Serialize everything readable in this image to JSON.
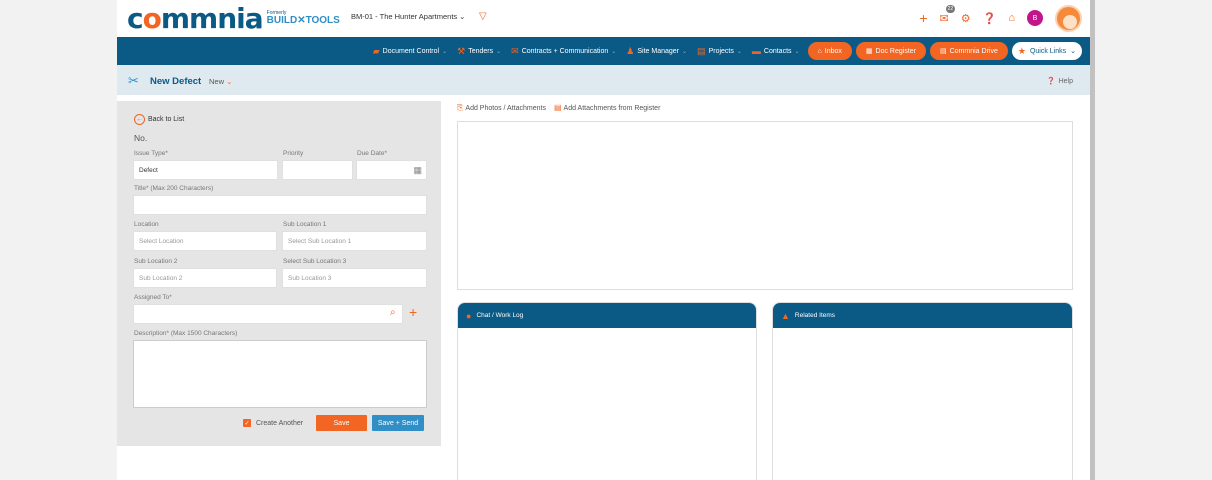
{
  "brand": {
    "logo_text": "commnia",
    "formerly": "Formerly",
    "build_tools": "BUILD✕TOOLS"
  },
  "header": {
    "project": "BM-01 - The Hunter Apartments",
    "mail_count": "22",
    "user_initial": "B"
  },
  "nav": {
    "items": [
      {
        "label": "Document Control",
        "icon": "folder-icon"
      },
      {
        "label": "Tenders",
        "icon": "hammer-icon"
      },
      {
        "label": "Contracts + Communication",
        "icon": "envelope-icon"
      },
      {
        "label": "Site Manager",
        "icon": "workers-icon"
      },
      {
        "label": "Projects",
        "icon": "briefcase-icon"
      },
      {
        "label": "Contacts",
        "icon": "chat-icon"
      }
    ],
    "inbox": "Inbox",
    "doc_register": "Doc Register",
    "drive": "Commnia Drive",
    "quick_links": "Quick Links"
  },
  "title": {
    "page": "New Defect",
    "status": "New",
    "help": "Help"
  },
  "form": {
    "back": "Back to List",
    "no_label": "No.",
    "issue_type_label": "Issue Type*",
    "issue_type_value": "Defect",
    "priority_label": "Priority",
    "due_date_label": "Due Date*",
    "title_label": "Title* (Max 200 Characters)",
    "location_label": "Location",
    "location_ph": "Select Location",
    "sub1_label": "Sub Location 1",
    "sub1_ph": "Select Sub Location 1",
    "sub2_label": "Sub Location 2",
    "sub2_ph": "Sub Location 2",
    "sub3_label": "Select Sub Location 3",
    "sub3_ph": "Sub Location 3",
    "assigned_label": "Assigned To*",
    "description_label": "Description* (Max 1500 Characters)",
    "create_another": "Create Another",
    "save": "Save",
    "save_send": "Save + Send"
  },
  "attachments": {
    "add_photos": "Add Photos / Attachments",
    "add_register": "Add Attachments from Register"
  },
  "panels": {
    "chat": "Chat / Work Log",
    "related": "Related Items"
  },
  "colors": {
    "brand_blue": "#0b5a86",
    "accent_orange": "#f26522",
    "action_blue": "#2f8fc6"
  }
}
